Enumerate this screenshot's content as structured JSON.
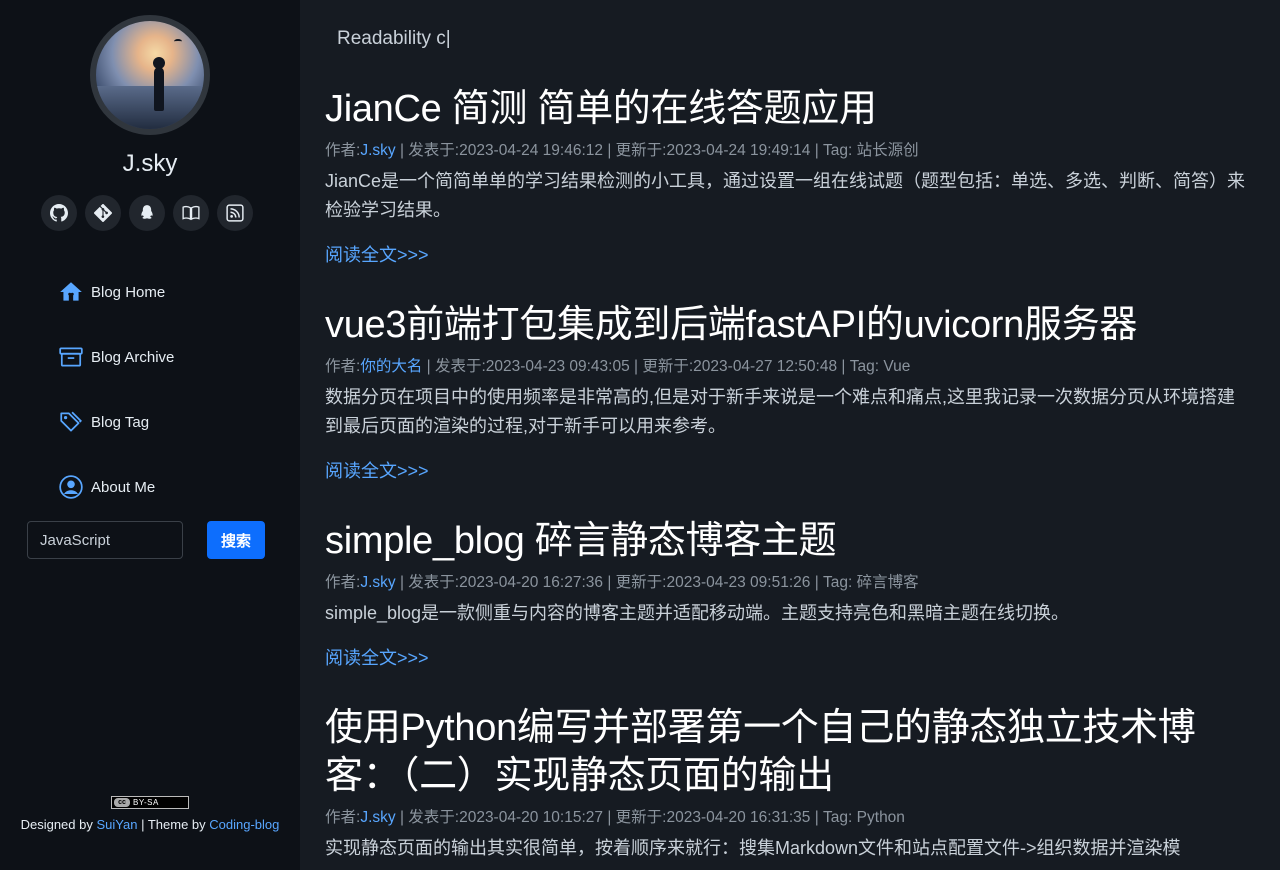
{
  "sidebar": {
    "site_name": "J.sky",
    "social_icons": [
      "github-icon",
      "git-icon",
      "qq-icon",
      "book-icon",
      "rss-icon"
    ],
    "nav": [
      {
        "label": "Blog Home",
        "icon": "home-icon"
      },
      {
        "label": "Blog Archive",
        "icon": "archive-icon"
      },
      {
        "label": "Blog Tag",
        "icon": "tag-icon"
      },
      {
        "label": "About Me",
        "icon": "user-icon"
      }
    ],
    "search": {
      "value": "JavaScript",
      "button_label": "搜索"
    },
    "license_badge": "BY-SA",
    "footer": {
      "designed_by": "Designed by",
      "designer": "SuiYan",
      "separator": "| Theme by",
      "theme": "Coding-blog"
    }
  },
  "main": {
    "typing_text": "Readability c|",
    "posts": [
      {
        "title": "JianCe 简测 简单的在线答题应用",
        "author_label": "作者:",
        "author": "J.sky",
        "published": "| 发表于:2023-04-24 19:46:12",
        "updated": "| 更新于:2023-04-24 19:49:14",
        "tag_label": "| Tag:",
        "tag": "站长源创",
        "excerpt": "JianCe是一个简简单单的学习结果检测的小工具，通过设置一组在线试题（题型包括：单选、多选、判断、简答）来检验学习结果。",
        "read_more": "阅读全文>>>"
      },
      {
        "title": "vue3前端打包集成到后端fastAPI的uvicorn服务器",
        "author_label": "作者:",
        "author": "你的大名",
        "published": "| 发表于:2023-04-23 09:43:05",
        "updated": "| 更新于:2023-04-27 12:50:48",
        "tag_label": "| Tag:",
        "tag": "Vue",
        "excerpt": "数据分页在项目中的使用频率是非常高的,但是对于新手来说是一个难点和痛点,这里我记录一次数据分页从环境搭建到最后页面的渲染的过程,对于新手可以用来参考。",
        "read_more": "阅读全文>>>"
      },
      {
        "title": "simple_blog 碎言静态博客主题",
        "author_label": "作者:",
        "author": "J.sky",
        "published": "| 发表于:2023-04-20 16:27:36",
        "updated": "| 更新于:2023-04-23 09:51:26",
        "tag_label": "| Tag:",
        "tag": "碎言博客",
        "excerpt": "simple_blog是一款侧重与内容的博客主题并适配移动端。主题支持亮色和黑暗主题在线切换。",
        "read_more": "阅读全文>>>"
      },
      {
        "title": "使用Python编写并部署第一个自己的静态独立技术博客：（二）实现静态页面的输出",
        "author_label": "作者:",
        "author": "J.sky",
        "published": "| 发表于:2023-04-20 10:15:27",
        "updated": "| 更新于:2023-04-20 16:31:35",
        "tag_label": "| Tag:",
        "tag": "Python",
        "excerpt": "实现静态页面的输出其实很简单，按着顺序来就行：搜集Markdown文件和站点配置文件->组织数据并渲染模",
        "read_more": "阅读全文>>>"
      }
    ]
  }
}
